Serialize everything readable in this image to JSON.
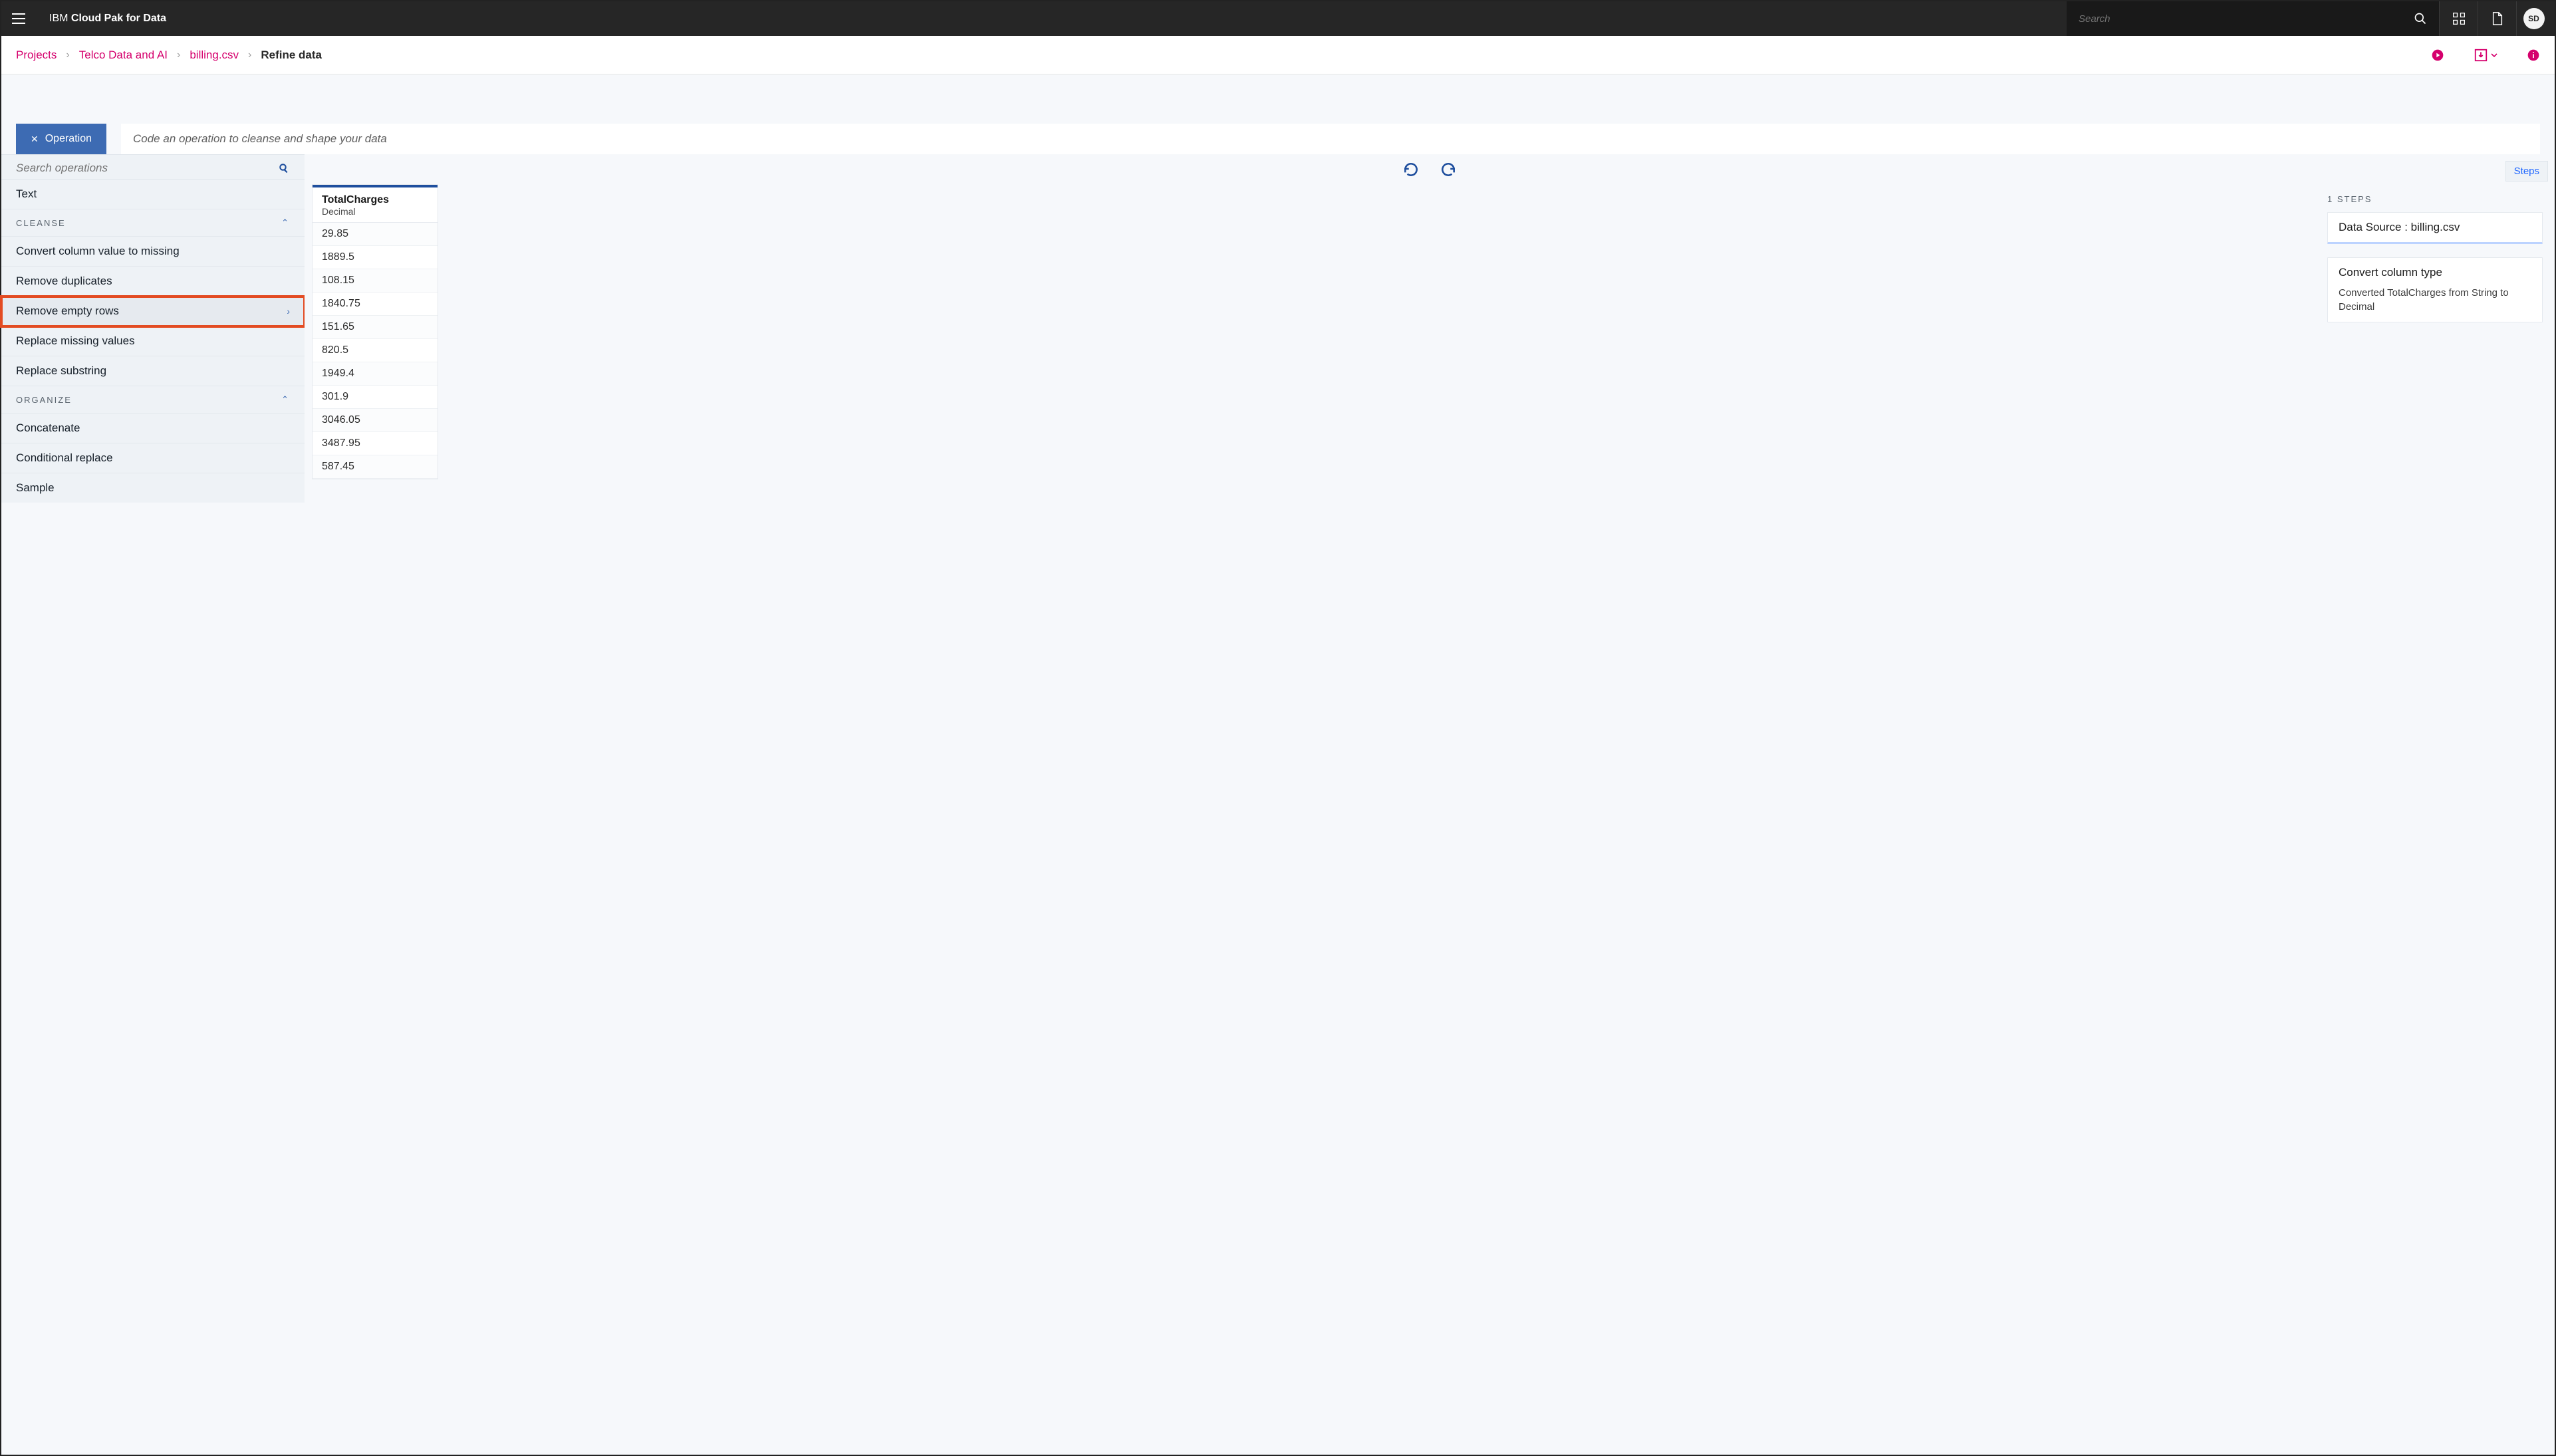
{
  "brand_prefix": "IBM ",
  "brand_bold": "Cloud Pak for Data",
  "search_placeholder": "Search",
  "avatar_initials": "SD",
  "breadcrumbs": {
    "0": "Projects",
    "1": "Telco Data and AI",
    "2": "billing.csv",
    "3": "Refine data"
  },
  "op_button": "Operation",
  "code_placeholder": "Code an operation to cleanse and shape your data",
  "ops_search_placeholder": "Search operations",
  "ops": {
    "text": "Text",
    "cat_cleanse": "CLEANSE",
    "convert_missing": "Convert column value to missing",
    "remove_dupes": "Remove duplicates",
    "remove_empty": "Remove empty rows",
    "replace_missing": "Replace missing values",
    "replace_substring": "Replace substring",
    "cat_organize": "ORGANIZE",
    "concatenate": "Concatenate",
    "conditional_replace": "Conditional replace",
    "sample": "Sample"
  },
  "column": {
    "name": "TotalCharges",
    "type": "Decimal",
    "cells": [
      "29.85",
      "1889.5",
      "108.15",
      "1840.75",
      "151.65",
      "820.5",
      "1949.4",
      "301.9",
      "3046.05",
      "3487.95",
      "587.45"
    ]
  },
  "steps_tab": "Steps",
  "steps_count_label": "1 STEPS",
  "steps": {
    "datasource": "Data Source : billing.csv",
    "s1_title": "Convert column type",
    "s1_desc": "Converted TotalCharges from String to Decimal"
  }
}
